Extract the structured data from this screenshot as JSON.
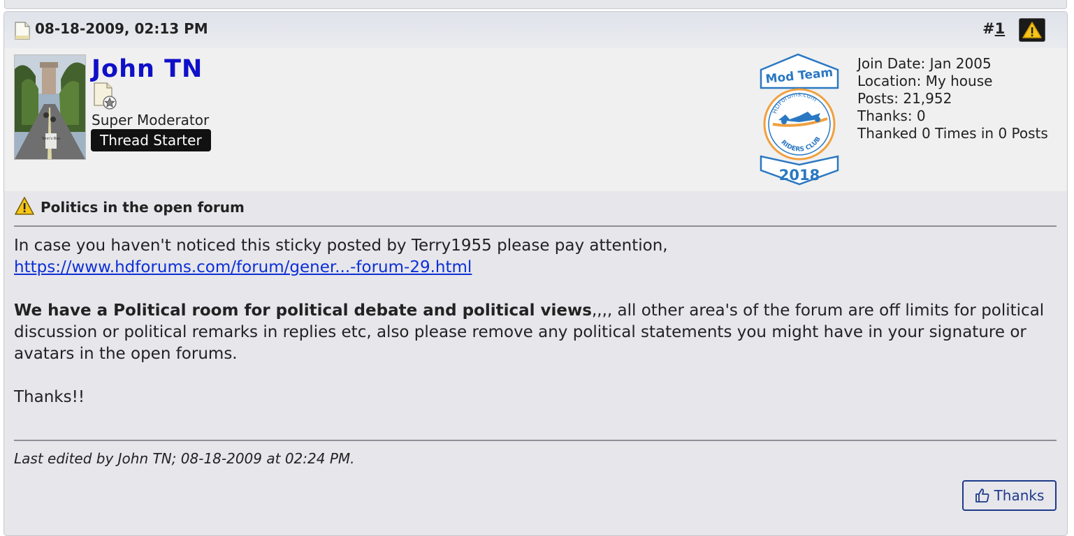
{
  "post": {
    "date": "08-18-2009, 02:13 PM",
    "number_prefix": "#",
    "number": "1",
    "icons": {
      "doc": "document-icon",
      "report": "report-warning-icon"
    }
  },
  "user": {
    "name": "John TN",
    "title": "Super Moderator",
    "badge": "Thread Starter",
    "avatar_caption": "Tenn's Bee",
    "stats": [
      "Join Date: Jan 2005",
      "Location: My house",
      "Posts: 21,952",
      "Thanks: 0",
      "Thanked 0 Times in 0 Posts"
    ],
    "mod_badge": {
      "top": "Mod Team",
      "ring": "HDForums.com",
      "bottom_ring": "RIDERS CLUB",
      "year": "2018"
    }
  },
  "body": {
    "title": "Politics in the open forum",
    "line1": "In case you haven't noticed this sticky posted by Terry1955 please pay attention,",
    "link": "https://www.hdforums.com/forum/gener...-forum-29.html",
    "bold": "We have a Political room for political debate and political views",
    "rest": ",,,, all other area's of the forum are off limits for political discussion or political remarks in replies etc, also please remove any political statements you might have in your signature or avatars in the open forums.",
    "closing": "Thanks!!"
  },
  "footer": {
    "edited": "Last edited by John TN; 08-18-2009 at 02:24 PM.",
    "thanks_label": "Thanks"
  },
  "colors": {
    "username": "#1010c8",
    "link": "#0d2fd6",
    "button": "#1e3a8a",
    "badge_blue": "#2a78c2",
    "badge_orange": "#f0a040"
  }
}
